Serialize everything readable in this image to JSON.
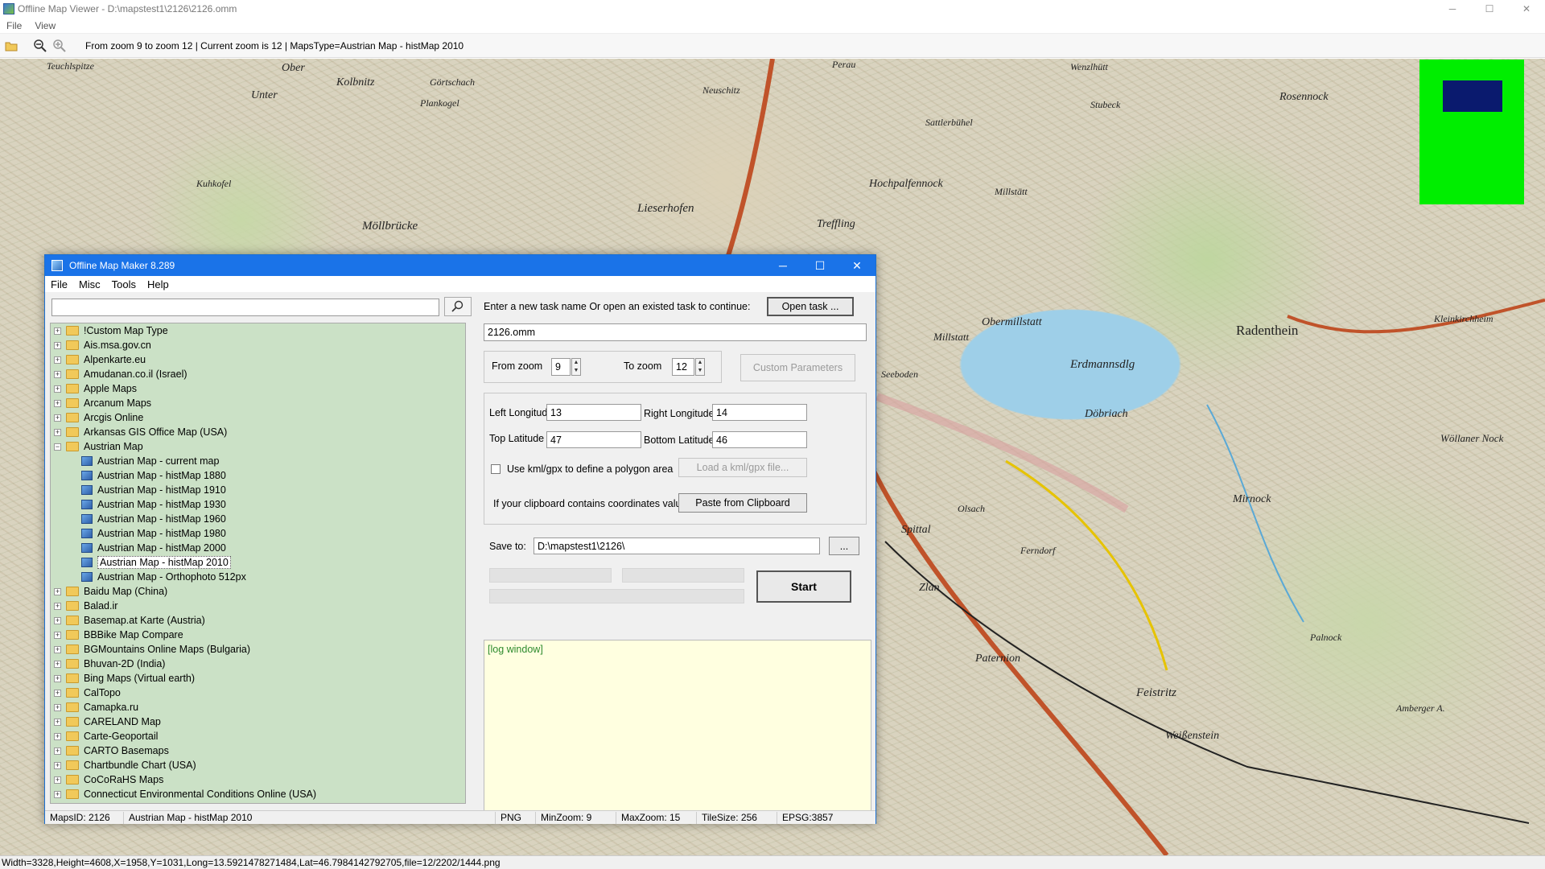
{
  "window": {
    "title": "Offline Map Viewer - D:\\mapstest1\\2126\\2126.omm",
    "min": "─",
    "max": "☐",
    "close": "✕"
  },
  "menu": {
    "file": "File",
    "view": "View"
  },
  "toolbar": {
    "info": "From zoom 9 to zoom 12   |   Current zoom is 12 |   MapsType=Austrian Map - histMap 2010"
  },
  "map_labels": [
    "Teuchlspitze",
    "Ober",
    "Kolbnitz",
    "Unter",
    "Görtschach",
    "Plankogel",
    "Neuschitz",
    "Perau",
    "Sattlerbühel",
    "Wenzlhütt",
    "Rosennock",
    "Kuhkofel",
    "Stubeck",
    "Millstätt",
    "Hochpalfennock",
    "Möllbrücke",
    "Lieserhofen",
    "Treffling",
    "Radenthein",
    "Obermillstatt",
    "Millstatt",
    "Erdmannsdlg",
    "Döbriach",
    "Spittal",
    "Zlan",
    "Paternion",
    "Feistritz",
    "Weißenstein",
    "Mirnock",
    "Palnock",
    "Kleinkirchheim",
    "Wöllaner Nock",
    "Amberger A.",
    "Seeboden",
    "Olsach",
    "Ferndorf"
  ],
  "minimap": {
    "bg": "#00ee00",
    "viewport": "#0a1a6e"
  },
  "statusbar": {
    "text": "Width=3328,Height=4608,X=1958,Y=1031,Long=13.5921478271484,Lat=46.7984142792705,file=12/2202/1444.png"
  },
  "dialog": {
    "title": "Offline Map Maker 8.289",
    "min": "─",
    "max": "☐",
    "close": "✕",
    "menu": {
      "file": "File",
      "misc": "Misc",
      "tools": "Tools",
      "help": "Help"
    },
    "search": {
      "value": "",
      "icon": "search-icon"
    },
    "tree": [
      {
        "label": "!Custom Map Type"
      },
      {
        "label": "Ais.msa.gov.cn"
      },
      {
        "label": "Alpenkarte.eu"
      },
      {
        "label": "Amudanan.co.il (Israel)"
      },
      {
        "label": "Apple Maps"
      },
      {
        "label": "Arcanum Maps"
      },
      {
        "label": "Arcgis Online"
      },
      {
        "label": "Arkansas GIS Office Map (USA)"
      },
      {
        "label": "Austrian Map",
        "expanded": true
      },
      {
        "label": "Austrian Map - current map",
        "child": true
      },
      {
        "label": "Austrian Map - histMap 1880",
        "child": true
      },
      {
        "label": "Austrian Map - histMap 1910",
        "child": true
      },
      {
        "label": "Austrian Map - histMap 1930",
        "child": true
      },
      {
        "label": "Austrian Map - histMap 1960",
        "child": true
      },
      {
        "label": "Austrian Map - histMap 1980",
        "child": true
      },
      {
        "label": "Austrian Map - histMap 2000",
        "child": true
      },
      {
        "label": "Austrian Map - histMap 2010",
        "child": true,
        "selected": true
      },
      {
        "label": "Austrian Map - Orthophoto 512px",
        "child": true
      },
      {
        "label": "Baidu Map (China)"
      },
      {
        "label": "Balad.ir"
      },
      {
        "label": "Basemap.at Karte (Austria)"
      },
      {
        "label": "BBBike Map Compare"
      },
      {
        "label": "BGMountains Online Maps (Bulgaria)"
      },
      {
        "label": "Bhuvan-2D (India)"
      },
      {
        "label": "Bing Maps (Virtual earth)"
      },
      {
        "label": "CalTopo"
      },
      {
        "label": "Camapka.ru"
      },
      {
        "label": "CARELAND Map"
      },
      {
        "label": "Carte-Geoportail"
      },
      {
        "label": "CARTO Basemaps"
      },
      {
        "label": "Chartbundle Chart (USA)"
      },
      {
        "label": "CoCoRaHS Maps"
      },
      {
        "label": "Connecticut Environmental Conditions Online (USA)"
      }
    ],
    "task": {
      "prompt": "Enter a new task name Or open an existed task to continue:",
      "open_btn": "Open task ...",
      "name": "2126.omm"
    },
    "zoom": {
      "from_label": "From zoom",
      "from_value": "9",
      "to_label": "To zoom",
      "to_value": "12",
      "custom_btn": "Custom Parameters"
    },
    "coords": {
      "left_lon_label": "Left Longitude",
      "left_lon": "13",
      "right_lon_label": "Right Longitude",
      "right_lon": "14",
      "top_lat_label": "Top Latitude",
      "top_lat": "47",
      "bottom_lat_label": "Bottom Latitude",
      "bottom_lat": "46",
      "kml_label": "Use kml/gpx to define a polygon area",
      "kml_btn": "Load a kml/gpx file...",
      "clip_label": "If your clipboard contains coordinates values:",
      "clip_btn": "Paste from Clipboard"
    },
    "save": {
      "label": "Save to:",
      "path": "D:\\mapstest1\\2126\\",
      "browse": "..."
    },
    "start": "Start",
    "log": "[log window]",
    "status": {
      "maps_id": "MapsID: 2126",
      "map_name": "Austrian Map - histMap 2010",
      "format": "PNG",
      "min_zoom": "MinZoom: 9",
      "max_zoom": "MaxZoom: 15",
      "tile_size": "TileSize: 256",
      "epsg": "EPSG:3857"
    }
  }
}
